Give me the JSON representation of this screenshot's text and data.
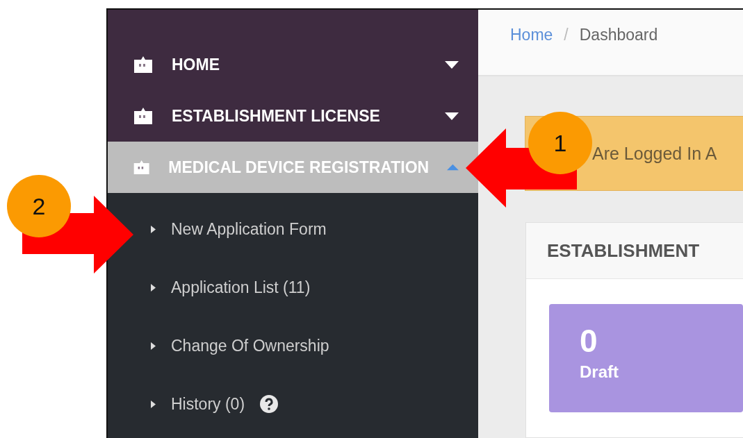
{
  "sidebar": {
    "items": [
      {
        "label": "HOME",
        "expanded": false,
        "selected": false
      },
      {
        "label": "ESTABLISHMENT LICENSE",
        "expanded": false,
        "selected": false
      },
      {
        "label": "MEDICAL DEVICE REGISTRATION",
        "expanded": true,
        "selected": true,
        "children": [
          {
            "label": "New Application Form",
            "help": false
          },
          {
            "label": "Application List (11)",
            "help": false
          },
          {
            "label": "Change Of Ownership",
            "help": false
          },
          {
            "label": "History (0)",
            "help": true
          }
        ]
      }
    ]
  },
  "breadcrumb": [
    {
      "label": "Home",
      "kind": "link"
    },
    {
      "label": "/",
      "kind": "separator"
    },
    {
      "label": "Dashboard",
      "kind": "current"
    }
  ],
  "alert": {
    "text": "Are Logged In A"
  },
  "panel": {
    "title": "ESTABLISHMENT",
    "stats": [
      {
        "count": "0",
        "label": "Draft",
        "color": "#a994e0"
      }
    ]
  },
  "callouts": [
    {
      "number": "1",
      "kind": "leftward"
    },
    {
      "number": "2",
      "kind": "rightward"
    }
  ]
}
